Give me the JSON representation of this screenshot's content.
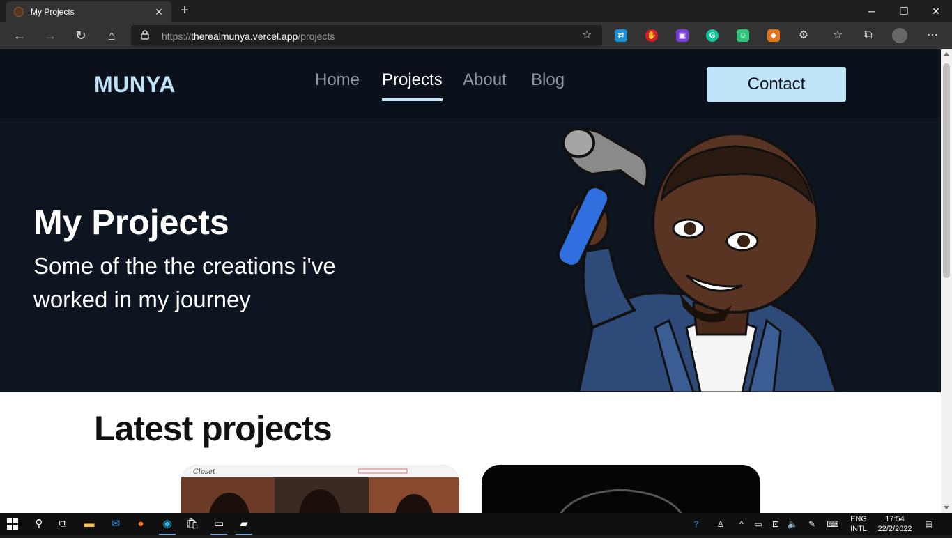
{
  "browser": {
    "tab": {
      "title": "My Projects"
    },
    "address": {
      "scheme": "https://",
      "domain": "therealmunya.vercel.app",
      "path": "/projects"
    }
  },
  "site": {
    "logo": "MUNYA",
    "nav": [
      "Home",
      "Projects",
      "About",
      "Blog"
    ],
    "active_nav": "Projects",
    "contact_button": "Contact",
    "hero": {
      "title": "My Projects",
      "subtitle": "Some of the the creations i've worked in my journey"
    },
    "section_title": "Latest projects",
    "card1_thumb_text": "Closet",
    "colors": {
      "nav_bg": "#0a111a",
      "hero_bg": "#0d1520",
      "accent": "#bfe3f7"
    }
  },
  "taskbar": {
    "language": [
      "ENG",
      "INTL"
    ],
    "time": "17:54",
    "date": "22/2/2022"
  }
}
